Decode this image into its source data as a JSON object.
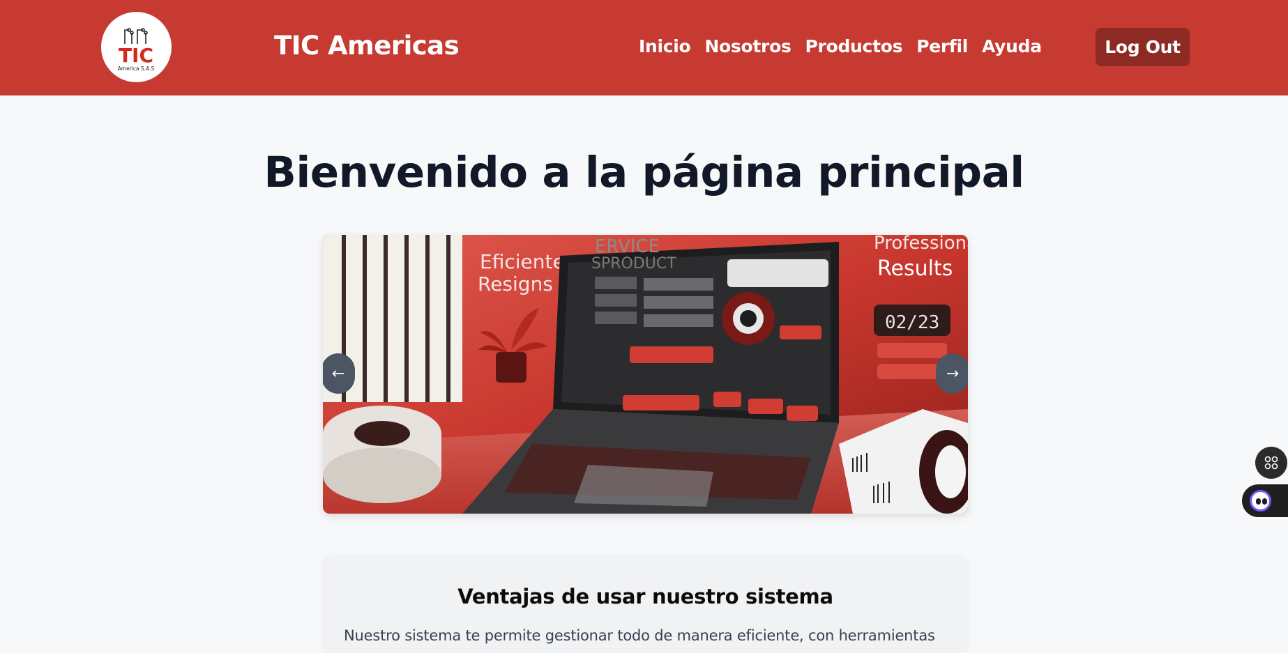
{
  "header": {
    "logo": {
      "icon": "tic-logo-icon",
      "text": "TIC",
      "subtext": "America S.A.S"
    },
    "brand": "TIC Americas",
    "nav": [
      {
        "label": "Inicio"
      },
      {
        "label": "Nosotros"
      },
      {
        "label": "Productos"
      },
      {
        "label": "Perfil"
      },
      {
        "label": "Ayuda"
      }
    ],
    "logout_label": "Log Out"
  },
  "main": {
    "title": "Bienvenido a la página principal",
    "carousel": {
      "prev_label": "←",
      "next_label": "→",
      "slide": {
        "left_text_1": "Eficiente",
        "left_text_2": "Resigns",
        "screen_title_1": "ERVICE",
        "screen_title_2": "SPRODUCT",
        "right_text_1": "Professional",
        "right_text_2": "Results",
        "counter": "02/23"
      }
    },
    "card": {
      "title": "Ventajas de usar nuestro sistema",
      "text": "Nuestro sistema te permite gestionar todo de manera eficiente, con herramientas"
    }
  },
  "widgets": {
    "grid_icon": "apps-grid-icon",
    "assistant_icon": "assistant-face-icon"
  },
  "colors": {
    "header_bg": "#c73a32",
    "logout_bg": "#8e2a24",
    "page_bg": "#f7f8fa",
    "arrow_bg": "#4b5563"
  }
}
